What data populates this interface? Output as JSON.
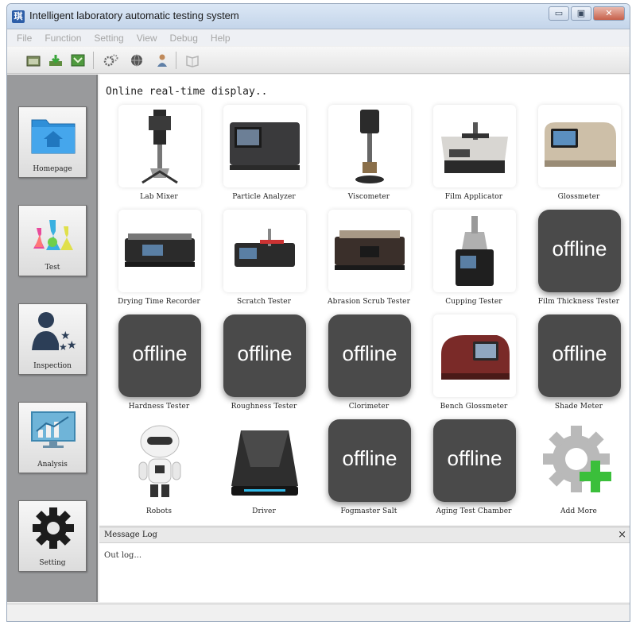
{
  "window": {
    "title": "Intelligent laboratory automatic testing system",
    "icon_char": "琪",
    "minimize_label": "▭",
    "maximize_label": "▣",
    "close_label": "✕"
  },
  "menu": [
    "File",
    "Function",
    "Setting",
    "View",
    "Debug",
    "Help"
  ],
  "toolbar": {
    "icons": [
      "open-icon",
      "download-icon",
      "export-icon",
      "gears-icon",
      "globe-icon",
      "user-icon",
      "book-icon"
    ]
  },
  "sidebar": {
    "items": [
      {
        "label": "Homepage",
        "icon": "home-folder-icon"
      },
      {
        "label": "Test",
        "icon": "flasks-icon"
      },
      {
        "label": "Inspection",
        "icon": "users-star-icon"
      },
      {
        "label": "Analysis",
        "icon": "chart-monitor-icon"
      },
      {
        "label": "Setting",
        "icon": "gear-icon"
      }
    ]
  },
  "main": {
    "title": "Online real-time display..",
    "offline_text": "offline",
    "devices": [
      {
        "label": "Lab Mixer",
        "status": "online",
        "icon": "lab-mixer-icon"
      },
      {
        "label": "Particle Analyzer",
        "status": "online",
        "icon": "particle-analyzer-icon"
      },
      {
        "label": "Viscometer",
        "status": "online",
        "icon": "viscometer-icon"
      },
      {
        "label": "Film Applicator",
        "status": "online",
        "icon": "film-applicator-icon"
      },
      {
        "label": "Glossmeter",
        "status": "online",
        "icon": "glossmeter-icon"
      },
      {
        "label": "Drying Time Recorder",
        "status": "online",
        "icon": "drying-time-recorder-icon"
      },
      {
        "label": "Scratch Tester",
        "status": "online",
        "icon": "scratch-tester-icon"
      },
      {
        "label": "Abrasion Scrub Tester",
        "status": "online",
        "icon": "abrasion-scrub-tester-icon"
      },
      {
        "label": "Cupping Tester",
        "status": "online",
        "icon": "cupping-tester-icon"
      },
      {
        "label": "Film Thickness Tester",
        "status": "offline",
        "icon": "offline-icon"
      },
      {
        "label": "Hardness Tester",
        "status": "offline",
        "icon": "offline-icon"
      },
      {
        "label": "Roughness Tester",
        "status": "offline",
        "icon": "offline-icon"
      },
      {
        "label": "Clorimeter",
        "status": "offline",
        "icon": "offline-icon"
      },
      {
        "label": "Bench Glossmeter",
        "status": "online",
        "icon": "bench-glossmeter-icon"
      },
      {
        "label": "Shade Meter",
        "status": "offline",
        "icon": "offline-icon"
      },
      {
        "label": "Robots",
        "status": "online",
        "icon": "robot-icon"
      },
      {
        "label": "Driver",
        "status": "online",
        "icon": "driver-icon"
      },
      {
        "label": "Fogmaster Salt",
        "status": "offline",
        "icon": "offline-icon"
      },
      {
        "label": "Aging Test Chamber",
        "status": "offline",
        "icon": "offline-icon"
      },
      {
        "label": "Add More",
        "status": "online",
        "icon": "add-gear-icon"
      }
    ]
  },
  "log": {
    "title": "Message Log",
    "close_label": "×",
    "text": "Out log..."
  },
  "colors": {
    "sidebar_bg": "#999a9c",
    "offline_tile": "#4a4a4a",
    "accent_blue": "#2f8fd8",
    "accent_green": "#3bbf3b"
  }
}
